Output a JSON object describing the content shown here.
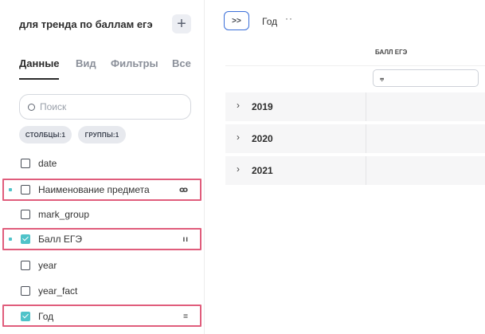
{
  "panel": {
    "title": "для тренда по баллам егэ",
    "add_label": "+"
  },
  "tabs": [
    {
      "label": "Данные",
      "active": true
    },
    {
      "label": "Вид",
      "active": false
    },
    {
      "label": "Фильтры",
      "active": false
    },
    {
      "label": "Все",
      "active": false
    }
  ],
  "search": {
    "placeholder": "Поиск"
  },
  "chips": [
    {
      "label": "СТОЛБЦЫ:1"
    },
    {
      "label": "ГРУППЫ:1"
    }
  ],
  "fields": [
    {
      "label": "date",
      "checked": false,
      "marked": false,
      "action": ""
    },
    {
      "label": "Наименование предмета",
      "checked": false,
      "marked": true,
      "action": "ꝏ"
    },
    {
      "label": "mark_group",
      "checked": false,
      "marked": false,
      "action": ""
    },
    {
      "label": "Балл ЕГЭ",
      "checked": true,
      "marked": true,
      "action": "ıı"
    },
    {
      "label": "year",
      "checked": false,
      "marked": false,
      "action": ""
    },
    {
      "label": "year_fact",
      "checked": false,
      "marked": false,
      "action": ""
    },
    {
      "label": "Год",
      "checked": true,
      "marked": false,
      "action": "="
    }
  ],
  "toolbar": {
    "expand_label": ">>",
    "group_label": "Год",
    "more_label": "··"
  },
  "table": {
    "column_header": "БАЛЛ ЕГЭ",
    "filter_icon": "filter-icon",
    "rows": [
      {
        "label": "2019"
      },
      {
        "label": "2020"
      },
      {
        "label": "2021"
      }
    ]
  },
  "colors": {
    "accent": "#4fc3c9",
    "highlight": "#e05d7c",
    "toolbar_border": "#3b6fd8"
  }
}
